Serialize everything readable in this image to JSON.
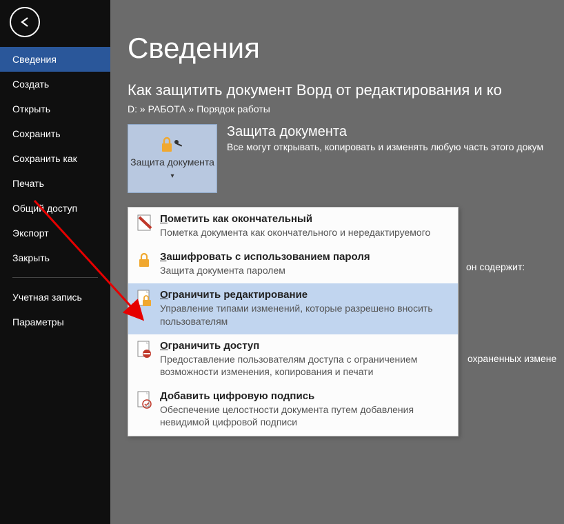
{
  "sidebar": {
    "items": [
      {
        "label": "Сведения",
        "active": true
      },
      {
        "label": "Создать"
      },
      {
        "label": "Открыть"
      },
      {
        "label": "Сохранить"
      },
      {
        "label": "Сохранить как"
      },
      {
        "label": "Печать"
      },
      {
        "label": "Общий доступ"
      },
      {
        "label": "Экспорт"
      },
      {
        "label": "Закрыть"
      }
    ],
    "bottom": [
      {
        "label": "Учетная запись"
      },
      {
        "label": "Параметры"
      }
    ]
  },
  "page": {
    "title": "Сведения",
    "doc_title": "Как защитить документ Ворд от редактирования и ко",
    "path": "D: » РАБОТА » Порядок работы"
  },
  "protect": {
    "button_label": "Защита документа",
    "heading": "Защита документа",
    "desc": "Все могут открывать, копировать и изменять любую часть этого докум"
  },
  "extra1": "он содержит:",
  "extra2": "охраненных измене",
  "menu": [
    {
      "title": "Пометить как окончательный",
      "u": "П",
      "desc": "Пометка документа как окончательного и нередактируемого",
      "icon": "pen"
    },
    {
      "title": "Зашифровать с использованием пароля",
      "u": "З",
      "desc": "Защита документа паролем",
      "icon": "lock"
    },
    {
      "title": "Ограничить редактирование",
      "u": "О",
      "desc": "Управление типами изменений, которые разрешено вносить пользователям",
      "icon": "doc-lock",
      "highlight": true
    },
    {
      "title": "Ограничить доступ",
      "u": "О",
      "desc": "Предоставление пользователям доступа с ограничением возможности изменения, копирования и печати",
      "icon": "doc-deny"
    },
    {
      "title": "Добавить цифровую подпись",
      "u": "Д",
      "desc": "Обеспечение целостности документа путем добавления невидимой цифровой подписи",
      "icon": "doc-sign"
    }
  ]
}
